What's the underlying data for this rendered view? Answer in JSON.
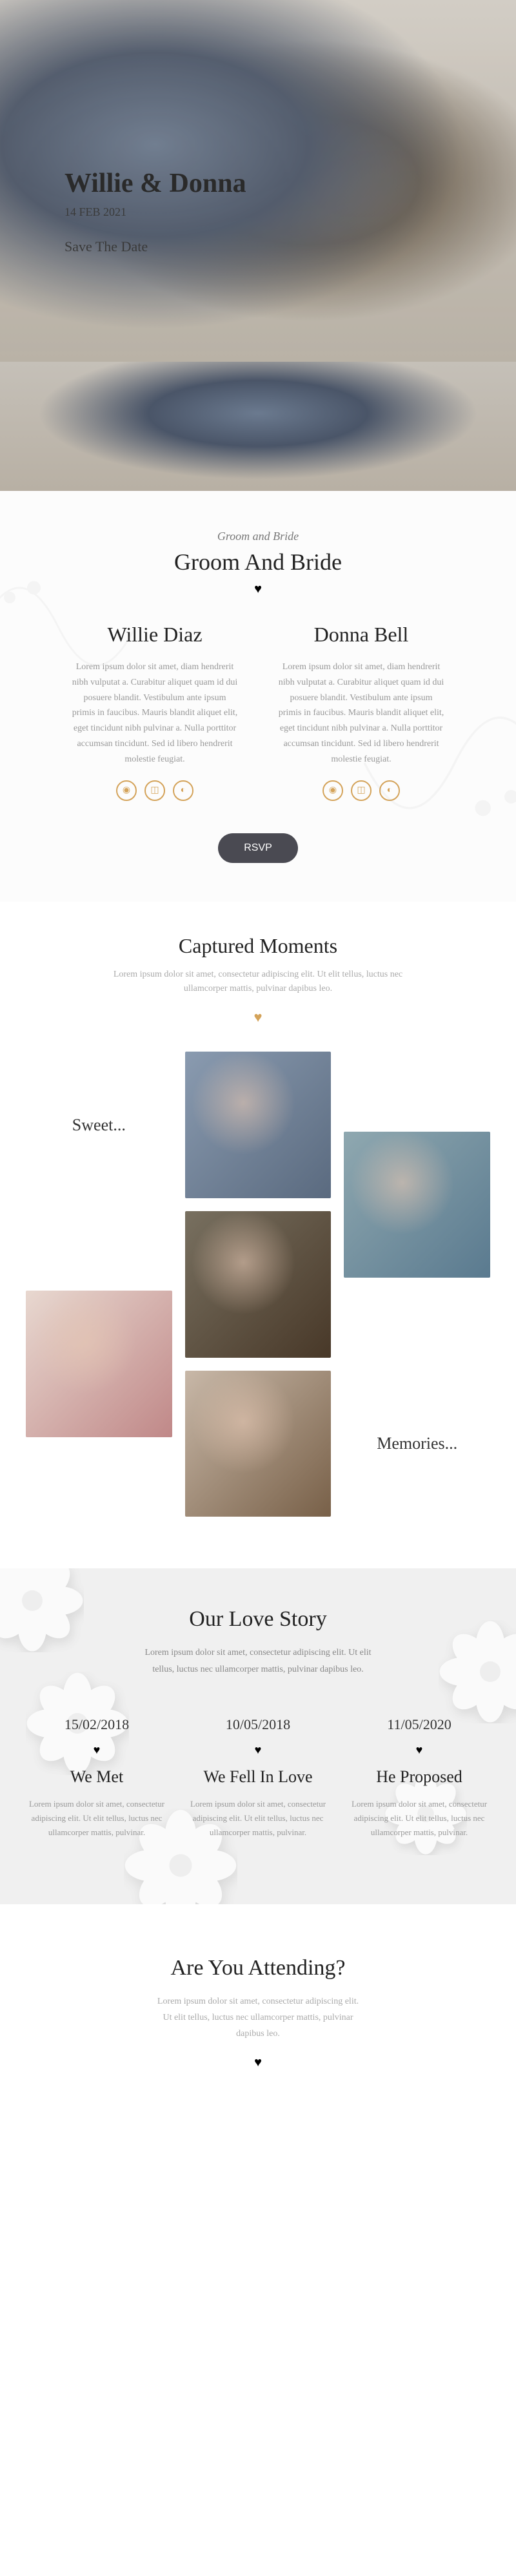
{
  "hero": {
    "title": "Willie & Donna",
    "date": "14 FEB 2021",
    "save": "Save The Date"
  },
  "couple_section": {
    "subtitle": "Groom and Bride",
    "title": "Groom And Bride",
    "groom": {
      "name": "Willie Diaz",
      "bio": "Lorem ipsum dolor sit amet, diam hendrerit nibh vulputat a. Curabitur aliquet quam id dui posuere blandit. Vestibulum ante ipsum primis in faucibus. Mauris blandit aliquet elit, eget tincidunt nibh pulvinar a. Nulla porttitor accumsan tincidunt. Sed id libero hendrerit molestie feugiat."
    },
    "bride": {
      "name": "Donna Bell",
      "bio": "Lorem ipsum dolor sit amet, diam hendrerit nibh vulputat a. Curabitur aliquet quam id dui posuere blandit. Vestibulum ante ipsum primis in faucibus. Mauris blandit aliquet elit, eget tincidunt nibh pulvinar a. Nulla porttitor accumsan tincidunt. Sed id libero hendrerit molestie feugiat."
    },
    "rsvp": "RSVP"
  },
  "moments": {
    "title": "Captured Moments",
    "desc": "Lorem ipsum dolor sit amet, consectetur adipiscing elit. Ut elit tellus, luctus nec ullamcorper mattis, pulvinar dapibus leo.",
    "label_left": "Sweet...",
    "label_right": "Memories..."
  },
  "story": {
    "title": "Our Love Story",
    "desc": "Lorem ipsum dolor sit amet, consectetur adipiscing elit. Ut elit tellus, luctus nec ullamcorper mattis, pulvinar dapibus leo.",
    "events": [
      {
        "date": "15/02/2018",
        "title": "We Met",
        "text": "Lorem ipsum dolor sit amet, consectetur adipiscing elit. Ut elit tellus, luctus nec ullamcorper mattis, pulvinar."
      },
      {
        "date": "10/05/2018",
        "title": "We Fell In Love",
        "text": "Lorem ipsum dolor sit amet, consectetur adipiscing elit. Ut elit tellus, luctus nec ullamcorper mattis, pulvinar."
      },
      {
        "date": "11/05/2020",
        "title": "He Proposed",
        "text": "Lorem ipsum dolor sit amet, consectetur adipiscing elit. Ut elit tellus, luctus nec ullamcorper mattis, pulvinar."
      }
    ]
  },
  "attend": {
    "title": "Are You Attending?",
    "desc": "Lorem ipsum dolor sit amet, consectetur adipiscing elit. Ut elit tellus, luctus nec ullamcorper mattis, pulvinar dapibus leo."
  }
}
